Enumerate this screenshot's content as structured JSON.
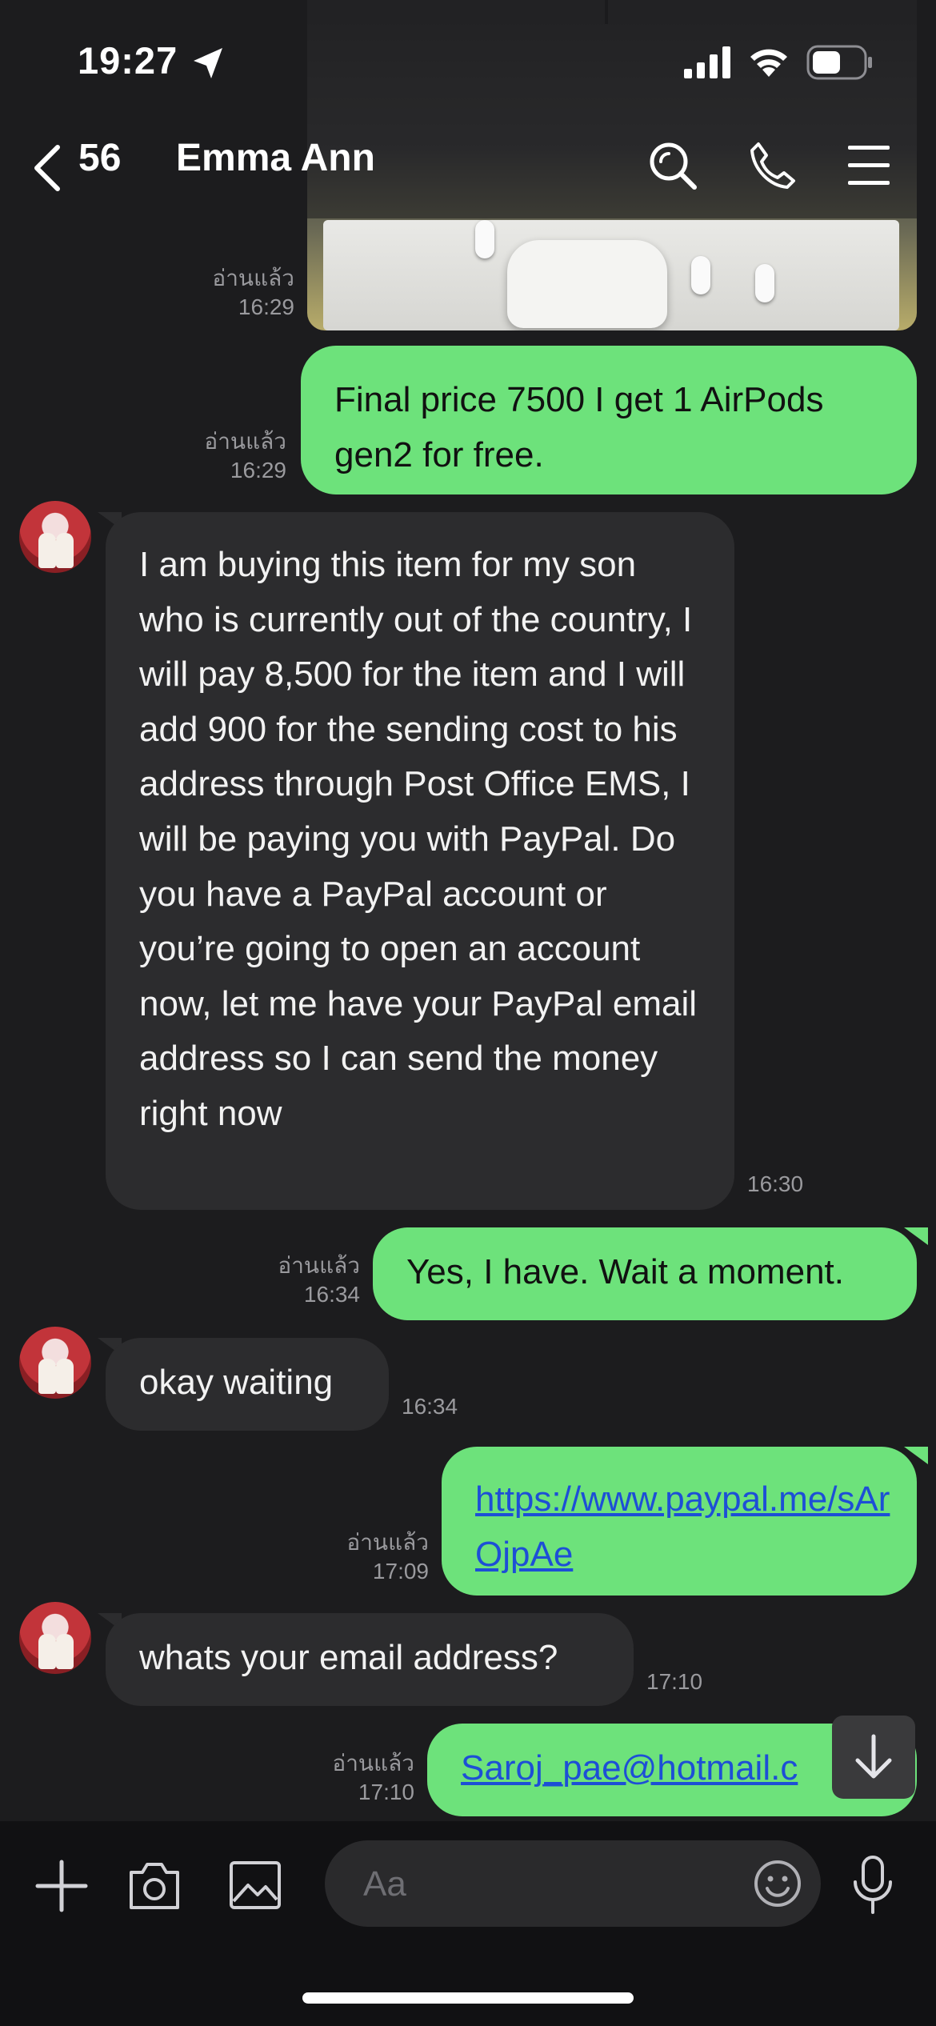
{
  "status_bar": {
    "time": "19:27"
  },
  "header": {
    "unread_count": "56",
    "title": "Emma Ann"
  },
  "messages": [
    {
      "read": "อ่านแล้ว",
      "time": "16:29"
    },
    {
      "read": "อ่านแล้ว",
      "time": "16:29",
      "text": "Final price 7500 I get 1 AirPods gen2 for free."
    },
    {
      "time": "16:30",
      "text": "I am buying this item for my son who is currently out of the country, I will pay 8,500 for the item and I will add 900 for the sending cost to his address through Post Office EMS, I will be paying you with PayPal. Do you have a PayPal account or you’re going to open an account now, let me have your PayPal email address so I can send the money right now"
    },
    {
      "read": "อ่านแล้ว",
      "time": "16:34",
      "text": "Yes, I have. Wait a moment."
    },
    {
      "time": "16:34",
      "text": "okay waiting"
    },
    {
      "read": "อ่านแล้ว",
      "time": "17:09",
      "text": "https://www.paypal.me/sArOjpAe"
    },
    {
      "time": "17:10",
      "text": "whats your email address?"
    },
    {
      "read": "อ่านแล้ว",
      "time": "17:10",
      "text": "Saroj_pae@hotmail.c"
    }
  ],
  "composer": {
    "placeholder": "Aa"
  },
  "colors": {
    "background": "#1c1c1e",
    "outgoing_bubble": "#6de27b",
    "incoming_bubble": "#2c2c2e",
    "link": "#1d4fd6"
  },
  "icons": [
    "location-arrow-icon",
    "cellular-signal-icon",
    "wifi-icon",
    "battery-icon",
    "back-chevron-icon",
    "search-icon",
    "phone-icon",
    "menu-icon",
    "scroll-down-arrow-icon",
    "plus-icon",
    "camera-icon",
    "image-icon",
    "emoji-icon",
    "microphone-icon"
  ]
}
